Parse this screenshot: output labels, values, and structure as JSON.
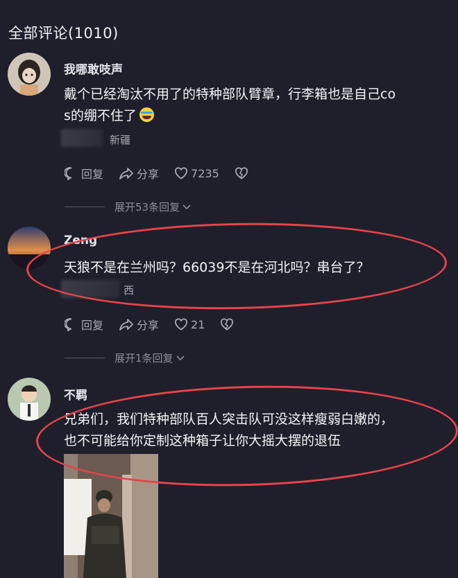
{
  "header": {
    "title": "全部评论(1010)"
  },
  "comments": [
    {
      "username": "我哪敢吱声",
      "text_line1": "戴个已经淘汰不用了的特种部队臂章，行李箱也是自己co",
      "text_line2": "s的绷不住了",
      "emoji_icon": "crying-laughing-emoji",
      "location": "新疆",
      "reply_label": "回复",
      "share_label": "分享",
      "likes": "7235",
      "expand_label": "展开53条回复"
    },
    {
      "username": "Zeng",
      "text_line1": "天狼不是在兰州吗？66039不是在河北吗？串台了？",
      "location": "西",
      "reply_label": "回复",
      "share_label": "分享",
      "likes": "21",
      "expand_label": "展开1条回复"
    },
    {
      "username": "不羁",
      "text_line1": "兄弟们，我们特种部队百人突击队可没这样瘦弱白嫩的，",
      "text_line2": "也不可能给你定制这种箱子让你大摇大摆的退伍"
    }
  ],
  "colors": {
    "background": "#1f1f2b",
    "annotation_red": "#e9434a",
    "muted_text": "#a9a9b4"
  }
}
